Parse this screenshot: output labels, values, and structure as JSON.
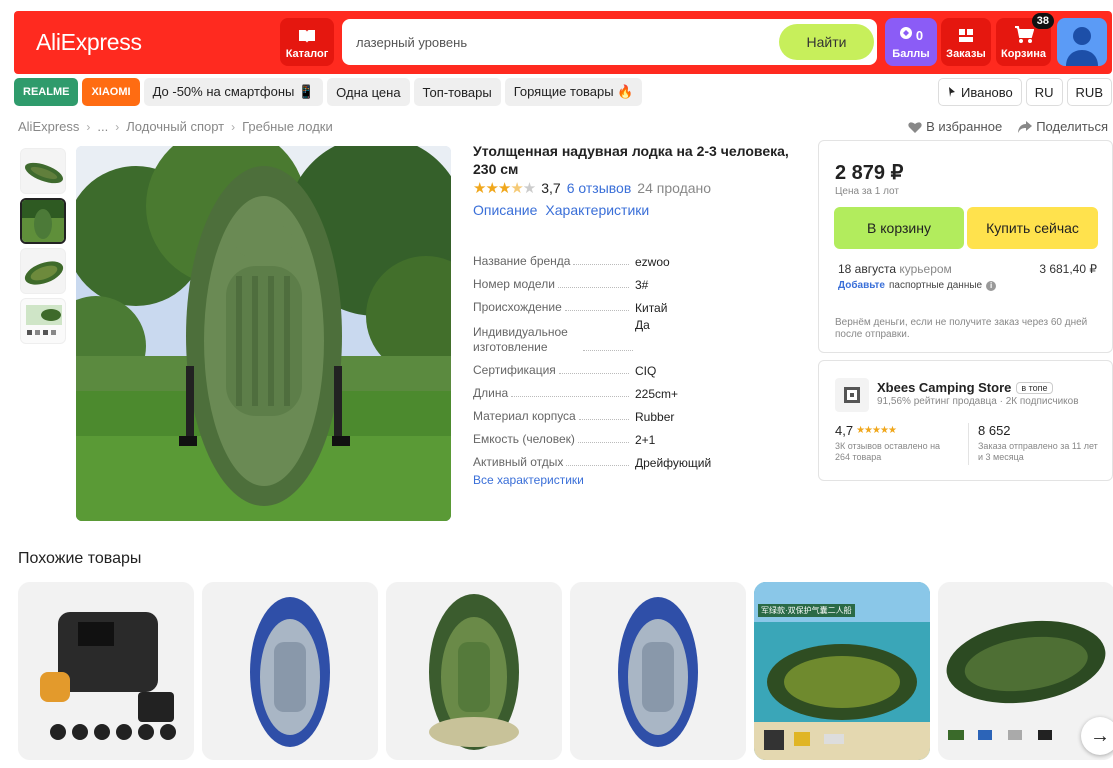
{
  "header": {
    "logo": "AliExpress",
    "catalog_label": "Каталог",
    "search_value": "лазерный уровень",
    "search_button": "Найти",
    "points_count": "0",
    "points_label": "Баллы",
    "orders_label": "Заказы",
    "cart_label": "Корзина",
    "cart_badge": "38"
  },
  "chips": [
    "REALME",
    "XIAOMI",
    "До -50% на смартфоны 📱",
    "Одна цена",
    "Топ-товары",
    "Горящие товары 🔥"
  ],
  "top_right_chips": {
    "city": "Иваново",
    "lang": "RU",
    "currency": "RUB"
  },
  "breadcrumbs": [
    "AliExpress",
    "...",
    "Лодочный спорт",
    "Гребные лодки"
  ],
  "actions": {
    "favorite": "В избранное",
    "share": "Поделиться"
  },
  "product": {
    "title": "Утолщенная надувная лодка на 2-3 человека, 230 см",
    "rating": "3,7",
    "reviews": "6 отзывов",
    "sold": "24 продано",
    "tab_description": "Описание",
    "tab_specs": "Характеристики",
    "specs": [
      {
        "k": "Название бренда",
        "v": "ezwoo"
      },
      {
        "k": "Номер модели",
        "v": "3#"
      },
      {
        "k": "Происхождение",
        "v": "Китай"
      },
      {
        "k": "Индивидуальное изготовление",
        "v": "Да"
      },
      {
        "k": "Сертификация",
        "v": "CIQ"
      },
      {
        "k": "Длина",
        "v": "225cm+"
      },
      {
        "k": "Материал корпуса",
        "v": "Rubber"
      },
      {
        "k": "Емкость (человек)",
        "v": "2+1"
      },
      {
        "k": "Активный отдых",
        "v": "Дрейфующий"
      }
    ],
    "all_specs": "Все характеристики"
  },
  "buybox": {
    "price": "2 879 ₽",
    "price_note": "Цена за 1 лот",
    "cart_button": "В корзину",
    "buy_button": "Купить сейчас",
    "delivery_date": "18 августа",
    "delivery_method": "курьером",
    "delivery_price": "3 681,40 ₽",
    "passport_link": "Добавьте",
    "passport_text": "паспортные данные",
    "refund": "Вернём деньги, если не получите заказ через 60 дней после отправки."
  },
  "store": {
    "name": "Xbees Camping Store",
    "tag": "в топе",
    "rating_line": "91,56% рейтинг продавца · 2К подписчиков",
    "score": "4,7",
    "score_desc": "3К отзывов оставлено на 264 товара",
    "shipped": "8 652",
    "shipped_desc": "Заказа отправлено за 11 лет и 3 месяца"
  },
  "similar": {
    "title": "Похожие товары",
    "card5_caption": "军绿款·双保护气囊二人船"
  },
  "colors": {
    "brand": "#ff2a1f",
    "cart_btn": "#b2ec5d",
    "buy_btn": "#ffe24d",
    "link": "#3a6fd8"
  }
}
